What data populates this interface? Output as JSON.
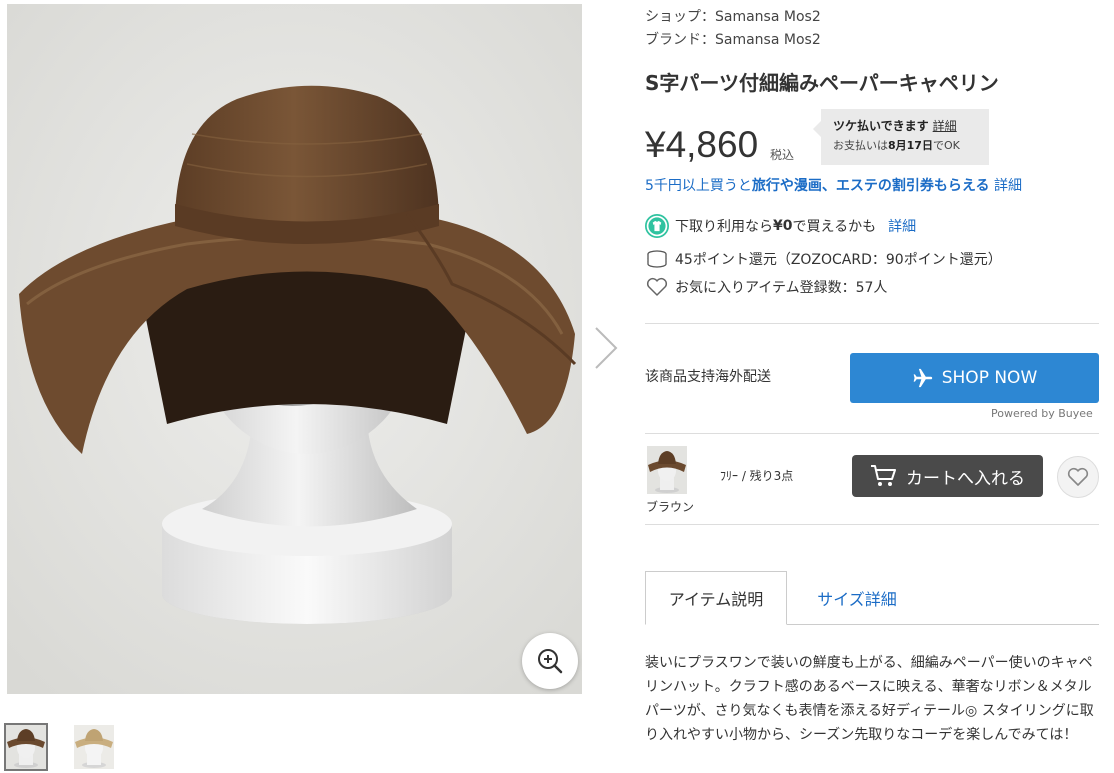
{
  "gallery": {
    "zoom_icon": "zoom-in-icon",
    "next_icon": "chevron-right-icon",
    "thumbnails": [
      {
        "name": "thumbnail-brown",
        "selected": true,
        "color": "#6b4a2f"
      },
      {
        "name": "thumbnail-beige",
        "selected": false,
        "color": "#c9ae7f"
      }
    ]
  },
  "product": {
    "shop_line": "ショップ：Samansa Mos2",
    "brand_line": "ブランド：Samansa Mos2",
    "title": "S字パーツ付細編みペーパーキャペリン",
    "price": "¥4,860",
    "tax_label": "税込",
    "tsuke": {
      "headline": "ツケ払いできます",
      "detail_link": "詳細",
      "pay_prefix": "お支払いは",
      "pay_date": "8月17日",
      "pay_suffix": "でOK"
    },
    "promo": {
      "prefix": "5千円以上買うと",
      "bold": "旅行や漫画、エステの割引券もらえる",
      "link": "詳細"
    },
    "tradein": {
      "prefix": "下取り利用なら",
      "bold": "¥0",
      "suffix": "で買えるかも",
      "link": "詳細"
    },
    "points": "45ポイント還元（ZOZOCARD：90ポイント還元）",
    "favorites": "お気に入りアイテム登録数：57人"
  },
  "shipping": {
    "label": "该商品支持海外配送",
    "button_label": "SHOP NOW",
    "button_icon": "airplane-icon",
    "powered_by": "Powered by Buyee"
  },
  "variant": {
    "color_label": "ブラウン",
    "stock": "ﾌﾘｰ / 残り3点",
    "cart_label": "カートへ入れる",
    "cart_icon": "cart-icon",
    "fav_icon": "heart-icon"
  },
  "tabs": [
    {
      "label": "アイテム説明",
      "active": true
    },
    {
      "label": "サイズ詳細",
      "active": false
    }
  ],
  "description": "装いにプラスワンで装いの鮮度も上がる、細編みペーパー使いのキャペリンハット。クラフト感のあるベースに映える、華奢なリボン＆メタルパーツが、さり気なくも表情を添える好ディテール◎ スタイリングに取り入れやすい小物から、シーズン先取りなコーデを楽しんでみては！",
  "colors": {
    "link": "#1b6cc6",
    "shop_now": "#2d87d3",
    "cart": "#4a4a4a",
    "hat": "#6b4a2f"
  }
}
